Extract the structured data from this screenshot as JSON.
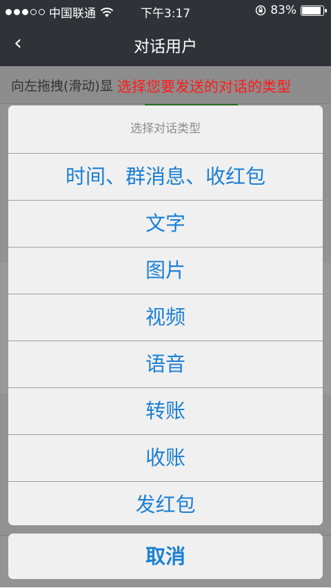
{
  "status_bar": {
    "carrier": "中国联通",
    "time": "下午3:17",
    "battery": "83%",
    "battery_level": 0.83
  },
  "nav": {
    "back_icon": "‹",
    "title": "对话用户"
  },
  "hint": {
    "text": "向左拖拽(滑动)显"
  },
  "red_tip": "选择您要发送的对话的类型",
  "action_sheet": {
    "title": "选择对话类型",
    "options": [
      "时间、群消息、收红包",
      "文字",
      "图片",
      "视频",
      "语音",
      "转账",
      "收账",
      "发红包"
    ],
    "cancel": "取消"
  },
  "colors": {
    "nav_bg": "#2f3237",
    "option_text": "#1a7fd6",
    "red_tip": "#ff1a1a",
    "accent_green": "#3fb93f"
  }
}
